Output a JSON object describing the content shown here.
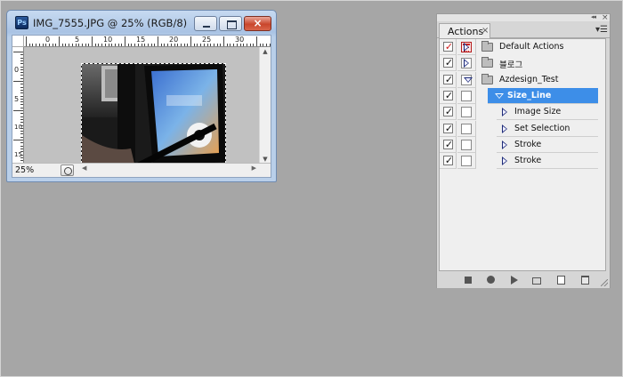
{
  "document_window": {
    "app_icon": "ps-icon",
    "title": "IMG_7555.JPG @ 25% (RGB/8)",
    "controls": {
      "minimize": "minimize-icon",
      "maximize": "maximize-icon",
      "close": "×"
    },
    "ruler_h_labels": [
      "0",
      "5",
      "10",
      "15",
      "20",
      "25",
      "30"
    ],
    "ruler_v_labels": [
      "0",
      "5",
      "10",
      "15"
    ],
    "zoom": "25%"
  },
  "actions_panel": {
    "tab_label": "Actions",
    "tab_close": "×",
    "menu_icon": "panel-menu-icon",
    "rows": [
      {
        "label": "Default Actions",
        "kind": "set",
        "expanded": false,
        "check": "red",
        "dialog": "red"
      },
      {
        "label": "블로그",
        "kind": "set",
        "expanded": false,
        "check": "black",
        "dialog": "none"
      },
      {
        "label": "Azdesign_Test",
        "kind": "set",
        "expanded": true,
        "check": "black",
        "dialog": "none"
      },
      {
        "label": "Size_Line",
        "kind": "action",
        "expanded": true,
        "selected": true,
        "check": "black",
        "dialog": "none"
      },
      {
        "label": "Image Size",
        "kind": "command",
        "expanded": false,
        "check": "black",
        "dialog": "none"
      },
      {
        "label": "Set Selection",
        "kind": "command",
        "expanded": false,
        "check": "black",
        "dialog": "none"
      },
      {
        "label": "Stroke",
        "kind": "command",
        "expanded": false,
        "check": "black",
        "dialog": "none"
      },
      {
        "label": "Stroke",
        "kind": "command",
        "expanded": false,
        "check": "black",
        "dialog": "none"
      }
    ],
    "bottom_buttons": [
      "stop-icon",
      "record-icon",
      "play-icon",
      "new-set-icon",
      "new-action-icon",
      "trash-icon"
    ]
  },
  "colors": {
    "background": "#a6a6a6",
    "selection": "#3d8ee8",
    "close_button": "#c9462c",
    "check_red": "#d01818"
  }
}
